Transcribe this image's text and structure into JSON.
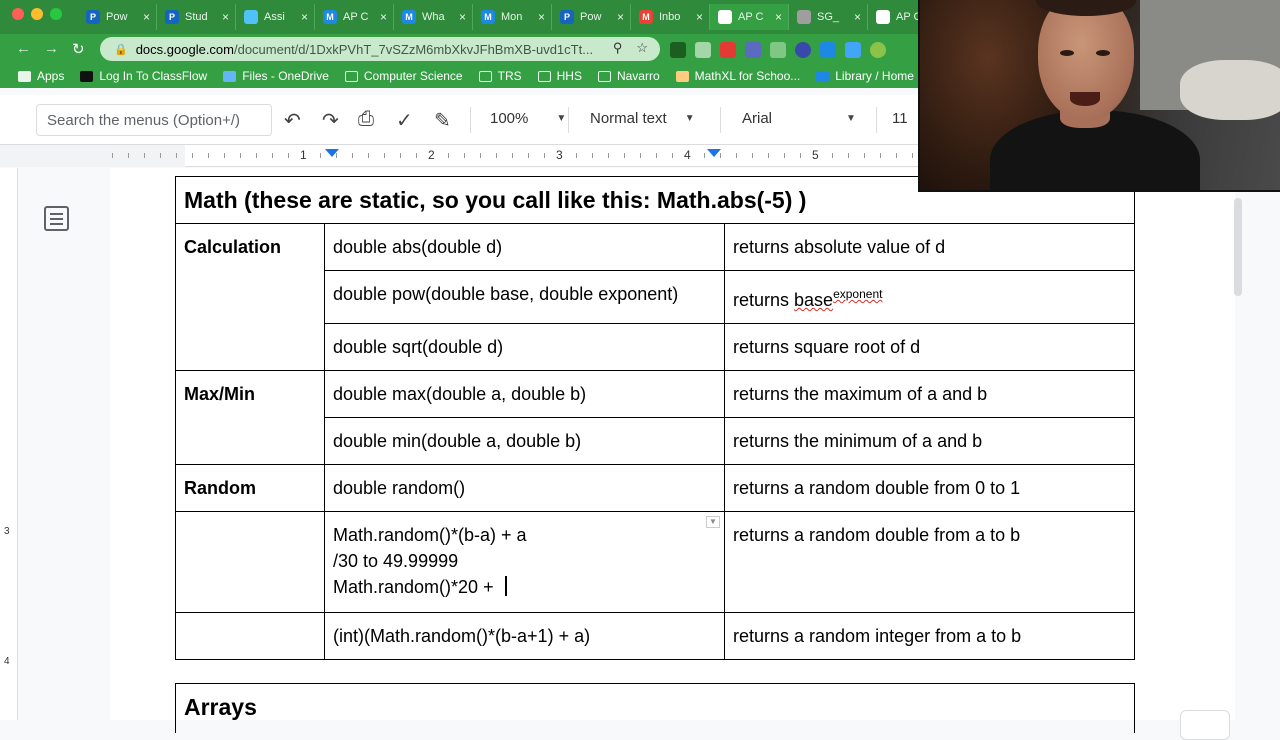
{
  "browser": {
    "tabs": [
      {
        "title": "Pow",
        "fav_color": "#1565c0",
        "fav_glyph": "P",
        "icon": "powerschool-icon"
      },
      {
        "title": "Stud",
        "fav_color": "#1565c0",
        "fav_glyph": "P",
        "icon": "powerschool-icon"
      },
      {
        "title": "Assi",
        "fav_color": "#4fc3f7",
        "fav_glyph": "",
        "icon": "classroom-icon"
      },
      {
        "title": "AP C",
        "fav_color": "#1e88e5",
        "fav_glyph": "M",
        "icon": "collegeboard-icon"
      },
      {
        "title": "Wha",
        "fav_color": "#1e88e5",
        "fav_glyph": "M",
        "icon": "collegeboard-icon"
      },
      {
        "title": "Mon",
        "fav_color": "#1e88e5",
        "fav_glyph": "M",
        "icon": "collegeboard-icon"
      },
      {
        "title": "Pow",
        "fav_color": "#1565c0",
        "fav_glyph": "P",
        "icon": "powerschool-icon"
      },
      {
        "title": "Inbo",
        "fav_color": "#ea4335",
        "fav_glyph": "M",
        "icon": "gmail-icon"
      },
      {
        "title": "AP C",
        "fav_color": "#ffffff",
        "fav_glyph": "",
        "icon": "shield-icon"
      },
      {
        "title": "SG_",
        "fav_color": "#9e9e9e",
        "fav_glyph": "",
        "icon": "globe-icon"
      },
      {
        "title": "AP C",
        "fav_color": "#ffffff",
        "fav_glyph": "",
        "icon": "shield-icon"
      }
    ],
    "url_host": "docs.google.com",
    "url_path": "/document/d/1DxkPVhT_7vSZzM6mbXkvJFhBmXB-uvd1cTt...",
    "bookmarks": [
      {
        "label": "Apps",
        "icon": "apps-grid-icon"
      },
      {
        "label": "Log In To ClassFlow",
        "icon": "classflow-icon"
      },
      {
        "label": "Files - OneDrive",
        "icon": "onedrive-icon"
      },
      {
        "label": "Computer Science",
        "icon": "folder-icon"
      },
      {
        "label": "TRS",
        "icon": "folder-icon"
      },
      {
        "label": "HHS",
        "icon": "folder-icon"
      },
      {
        "label": "Navarro",
        "icon": "folder-icon"
      },
      {
        "label": "MathXL for Schoo...",
        "icon": "mathxl-icon"
      },
      {
        "label": "Library / Home",
        "icon": "library-icon"
      }
    ]
  },
  "toolbar": {
    "search_placeholder": "Search the menus (Option+/)",
    "zoom": "100%",
    "style": "Normal text",
    "font": "Arial",
    "font_size": "11"
  },
  "ruler": {
    "numbers": [
      "1",
      "2",
      "3",
      "4",
      "5"
    ],
    "vertical_numbers": [
      "3",
      "4"
    ]
  },
  "doc": {
    "math_title": "Math (these are static, so you call like this: Math.abs(-5) )",
    "rows": [
      {
        "category": "Calculation",
        "signature": "double abs(double d)",
        "desc": "returns absolute value of d"
      },
      {
        "category": "",
        "signature": "double pow(double base, double exponent)",
        "desc_main": "returns ",
        "desc_base": "base",
        "desc_sup": "exponent"
      },
      {
        "category": "",
        "signature": "double sqrt(double d)",
        "desc": "returns square root of d"
      },
      {
        "category": "Max/Min",
        "signature": "double max(double a, double b)",
        "desc": "returns the maximum of a and b"
      },
      {
        "category": "",
        "signature": "double min(double a, double b)",
        "desc": "returns the minimum of a and b"
      },
      {
        "category": "Random",
        "signature": "double random()",
        "desc": "returns a random double from 0 to 1"
      },
      {
        "category": "",
        "signature_lines": [
          "Math.random()*(b-a) + a",
          "/30 to 49.99999",
          "Math.random()*20 + "
        ],
        "desc": "returns a random double from a to b"
      },
      {
        "category": "",
        "signature": "(int)(Math.random()*(b-a+1) + a)",
        "desc": "returns a random integer from a to b"
      }
    ],
    "arrays_title": "Arrays"
  }
}
